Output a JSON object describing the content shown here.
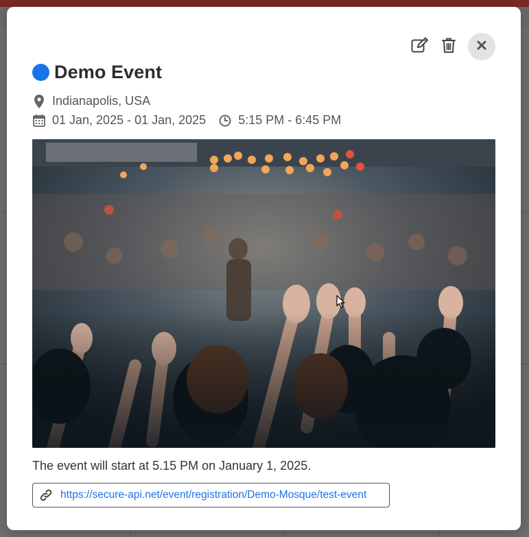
{
  "modal": {
    "title": "Demo Event",
    "accent_color": "#1a73e8",
    "location": "Indianapolis, USA",
    "date_range": "01 Jan, 2025 - 01 Jan, 2025",
    "time_range": "5:15 PM - 6:45 PM",
    "description": "The event will start at 5.15 PM on January 1, 2025.",
    "link_url": "https://secure-api.net/event/registration/Demo-Mosque/test-event",
    "image_alt": "Concert crowd with raised hands",
    "icons": {
      "edit": "edit-icon",
      "delete": "trash-icon",
      "close": "close-icon",
      "location": "map-pin-icon",
      "date": "calendar-icon",
      "time": "clock-icon",
      "link": "link-icon"
    }
  }
}
